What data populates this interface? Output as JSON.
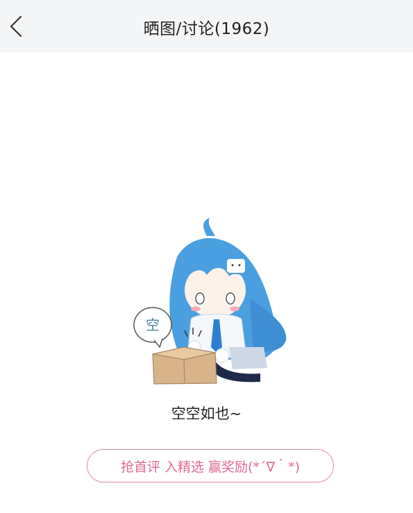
{
  "header": {
    "back_icon": "chevron-left-icon",
    "title": "晒图/讨论(1962)"
  },
  "empty_state": {
    "speech_bubble_text": "空",
    "message": "空空如也~",
    "cta_label": "抢首评 入精选 赢奖励(*´∇｀*)"
  },
  "colors": {
    "header_bg": "#f4f5f7",
    "cta_pink": "#e06a92",
    "cta_border": "#e58aa6",
    "hair_blue": "#4a9fe0"
  }
}
